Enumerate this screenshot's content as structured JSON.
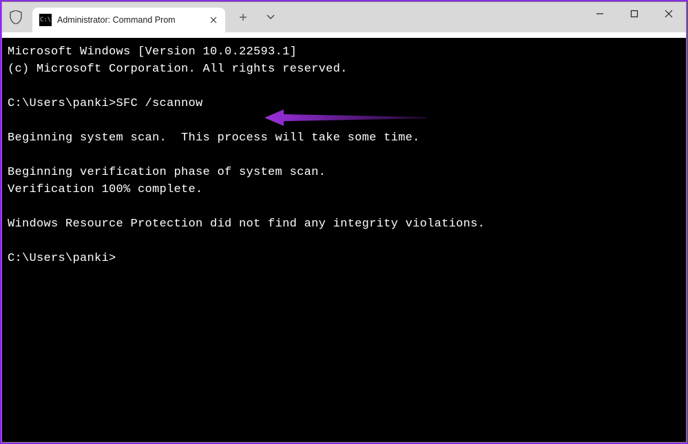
{
  "tab": {
    "title": "Administrator: Command Prom"
  },
  "terminal": {
    "line1": "Microsoft Windows [Version 10.0.22593.1]",
    "line2": "(c) Microsoft Corporation. All rights reserved.",
    "blank1": "",
    "prompt1": "C:\\Users\\panki>SFC /scannow",
    "blank2": "",
    "line3": "Beginning system scan.  This process will take some time.",
    "blank3": "",
    "line4": "Beginning verification phase of system scan.",
    "line5": "Verification 100% complete.",
    "blank4": "",
    "line6": "Windows Resource Protection did not find any integrity violations.",
    "blank5": "",
    "prompt2": "C:\\Users\\panki>"
  },
  "colors": {
    "annotation": "#9b2fe0"
  }
}
